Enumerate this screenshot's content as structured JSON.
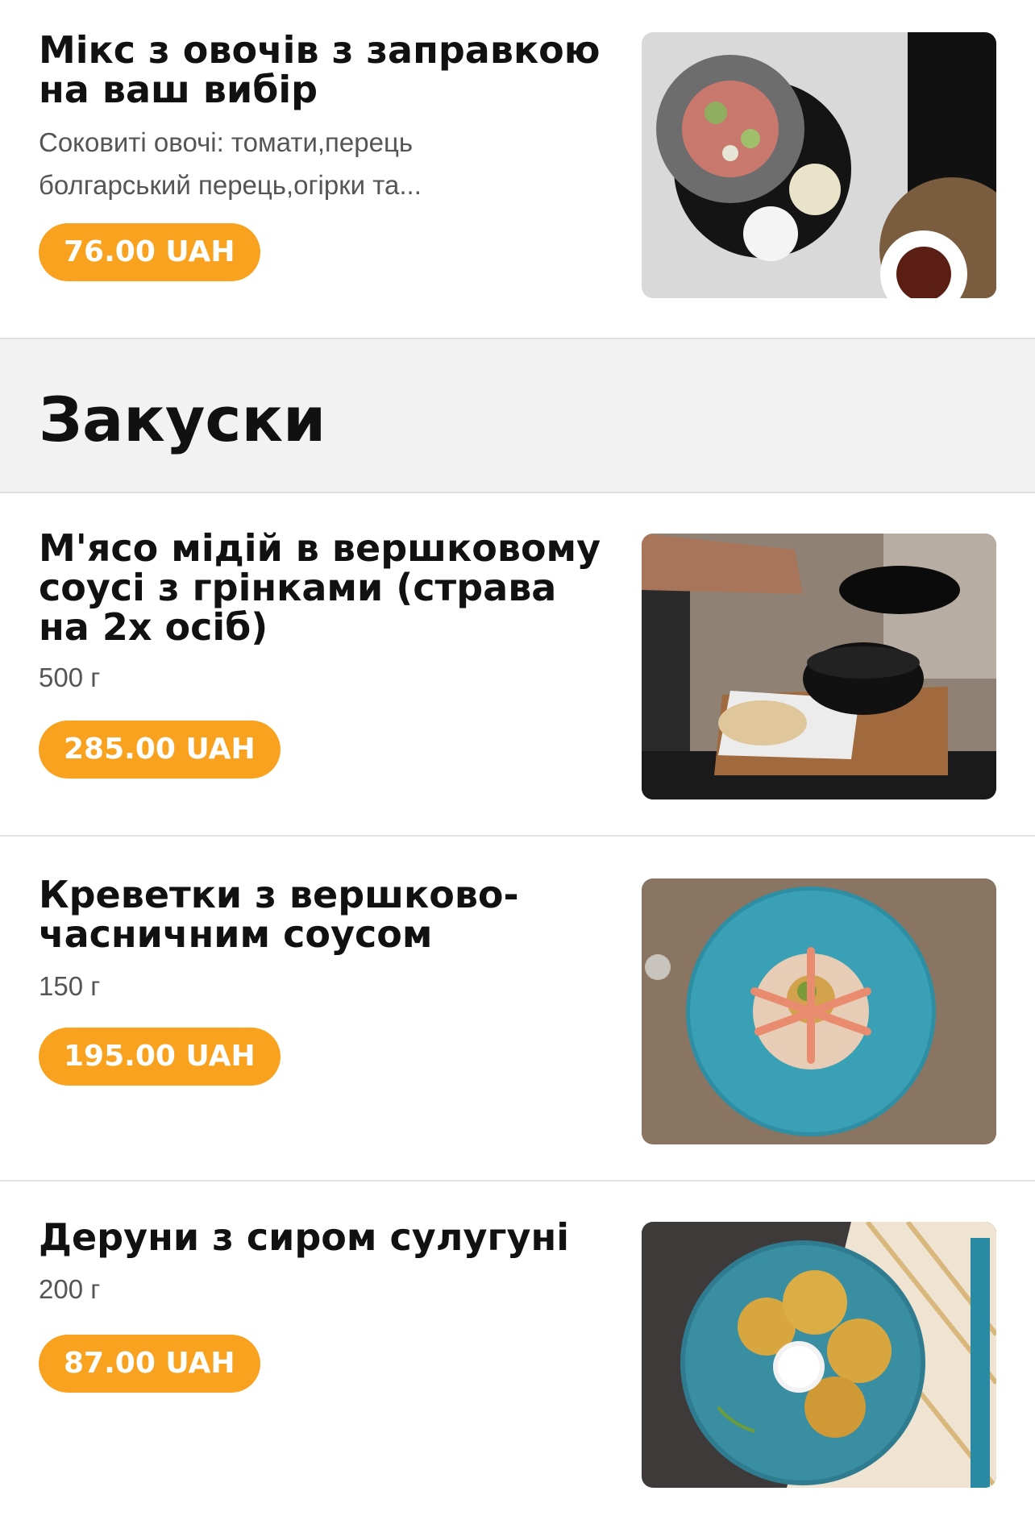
{
  "colors": {
    "accent": "#f9a21f",
    "section_bg": "#f2f2f2",
    "divider": "#e3e3e3"
  },
  "menu": {
    "top_item": {
      "title": "Мікс з овочів з заправкою на ваш вибір",
      "description": "Соковиті овочі: томати,перець болгарський перець,огірки та...",
      "price": "76.00 UAH",
      "image_icon": "salad-plate-photo"
    },
    "section": {
      "title": "Закуски",
      "items": [
        {
          "title": "М'ясо мідій в вершковому соусі з грінками (страва на 2х осіб)",
          "weight": "500 г",
          "price": "285.00 UAH",
          "image_icon": "mussels-pot-photo"
        },
        {
          "title": "Креветки з вершково-часничним соусом",
          "weight": "150 г",
          "price": "195.00 UAH",
          "image_icon": "shrimp-plate-photo"
        },
        {
          "title": "Деруни з сиром сулугуні",
          "weight": "200 г",
          "price": "87.00 UAH",
          "image_icon": "potato-pancakes-photo"
        }
      ]
    }
  }
}
